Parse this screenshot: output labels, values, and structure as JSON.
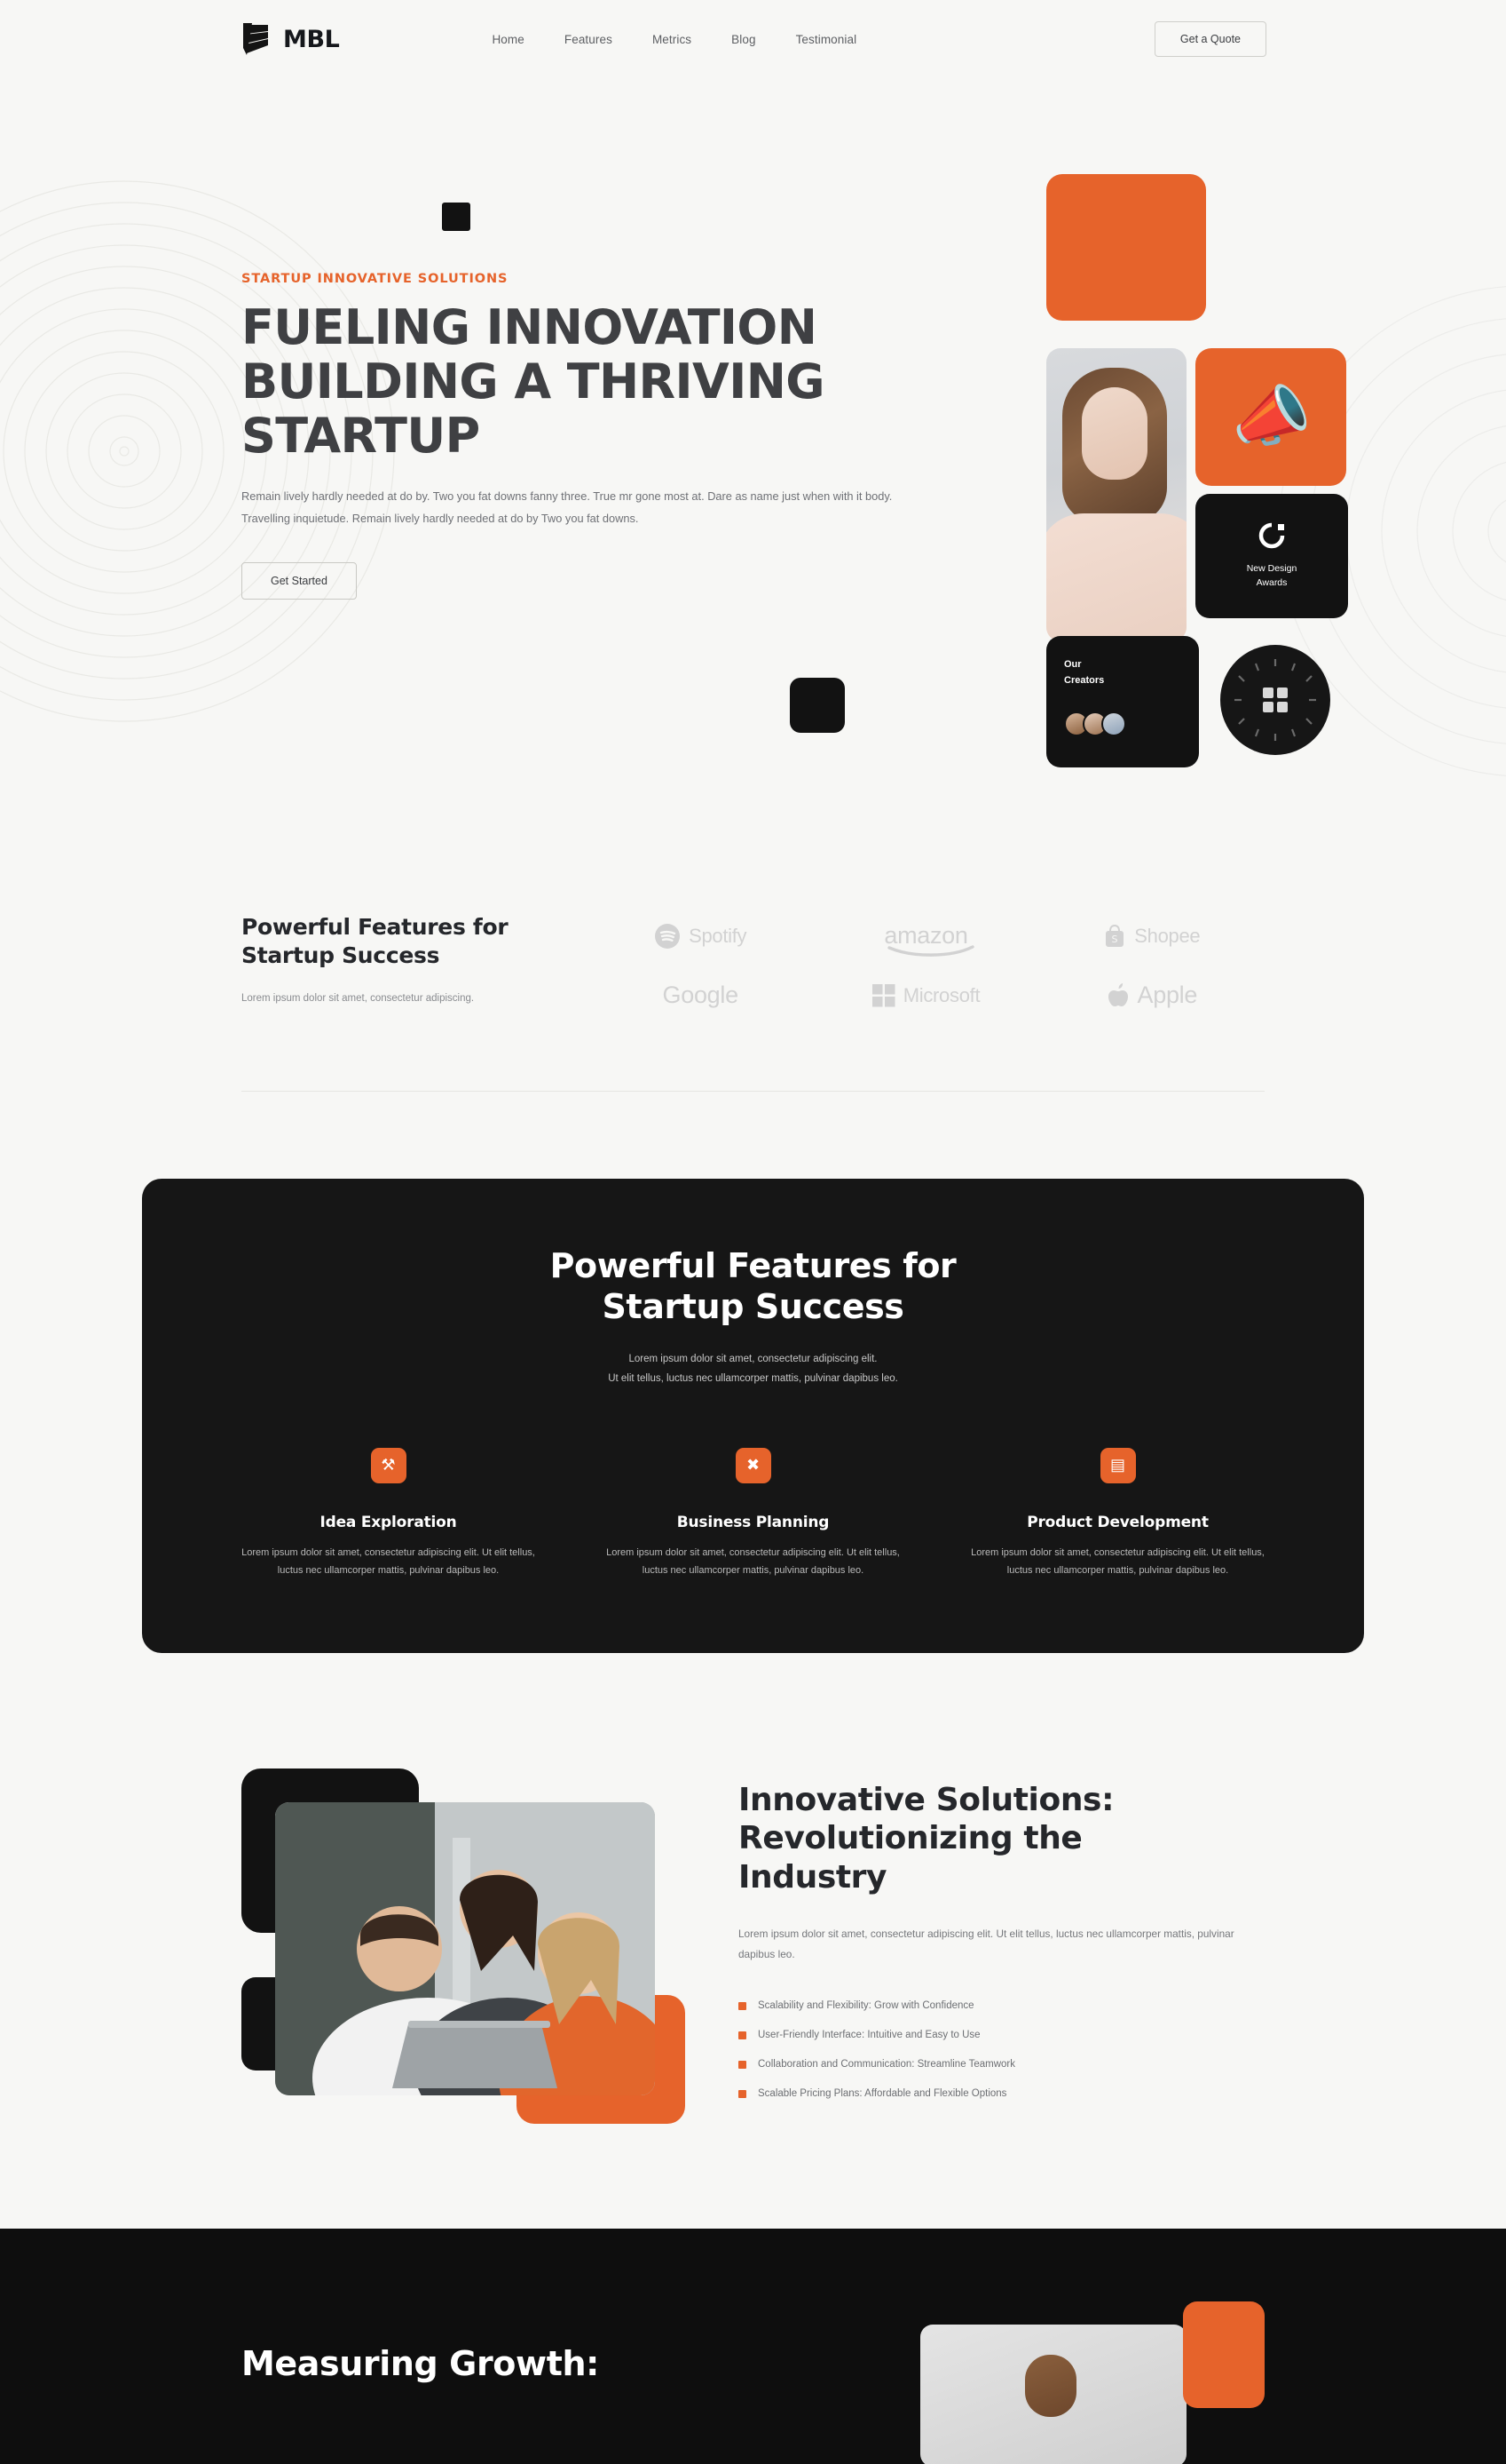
{
  "brand": {
    "name": "MBL",
    "logo_icon": "stacked-layers-icon"
  },
  "nav": {
    "items": [
      {
        "label": "Home"
      },
      {
        "label": "Features"
      },
      {
        "label": "Metrics"
      },
      {
        "label": "Blog"
      },
      {
        "label": "Testimonial"
      }
    ],
    "cta_label": "Get a Quote"
  },
  "hero": {
    "eyebrow": "STARTUP INNOVATIVE SOLUTIONS",
    "title_line1": "FUELING INNOVATION",
    "title_line2": "BUILDING A THRIVING",
    "title_line3": "STARTUP",
    "description": "Remain lively hardly needed at do by. Two you fat downs fanny three. True mr gone most at. Dare as name just when with it body. Travelling inquietude. Remain lively hardly needed at do by Two you fat downs.",
    "cta_label": "Get Started",
    "collage": {
      "megaphone_icon": "megaphone-icon",
      "award_icon": "rotating-arrow-icon",
      "award_label_line1": "New Design",
      "award_label_line2": "Awards",
      "creators_label_line1": "Our",
      "creators_label_line2": "Creators",
      "badge_icon": "plus-circle-badge-icon"
    }
  },
  "brands_section": {
    "title_line1": "Powerful Features for",
    "title_line2": "Startup Success",
    "subtitle": "Lorem ipsum dolor sit amet, consectetur adipiscing.",
    "logos": [
      {
        "name": "Spotify",
        "icon": "spotify-icon"
      },
      {
        "name": "amazon",
        "icon": "amazon-wordmark-icon"
      },
      {
        "name": "Shopee",
        "icon": "shopee-bag-icon"
      },
      {
        "name": "Google",
        "icon": "google-wordmark-icon"
      },
      {
        "name": "Microsoft",
        "icon": "microsoft-squares-icon"
      },
      {
        "name": "Apple",
        "icon": "apple-icon"
      }
    ]
  },
  "features_section": {
    "title_line1": "Powerful Features for",
    "title_line2": "Startup Success",
    "lead_line1": "Lorem ipsum dolor sit amet, consectetur adipiscing elit.",
    "lead_line2": "Ut elit tellus, luctus nec ullamcorper mattis, pulvinar dapibus leo.",
    "cards": [
      {
        "icon": "idea-lightbulb-icon",
        "glyph": "⚒",
        "title": "Idea Exploration",
        "body": "Lorem ipsum dolor sit amet, consectetur adipiscing elit. Ut elit tellus, luctus nec ullamcorper mattis, pulvinar dapibus leo."
      },
      {
        "icon": "tools-wrench-icon",
        "glyph": "✖",
        "title": "Business Planning",
        "body": "Lorem ipsum dolor sit amet, consectetur adipiscing elit. Ut elit tellus, luctus nec ullamcorper mattis, pulvinar dapibus leo."
      },
      {
        "icon": "presentation-board-icon",
        "glyph": "▤",
        "title": "Product Development",
        "body": "Lorem ipsum dolor sit amet, consectetur adipiscing elit. Ut elit tellus, luctus nec ullamcorper mattis, pulvinar dapibus leo."
      }
    ]
  },
  "innovative_section": {
    "title_line1": "Innovative Solutions:",
    "title_line2": "Revolutionizing the",
    "title_line3": "Industry",
    "lead": "Lorem ipsum dolor sit amet, consectetur adipiscing elit. Ut elit tellus, luctus nec ullamcorper mattis, pulvinar dapibus leo.",
    "bullets": [
      "Scalability and Flexibility: Grow with Confidence",
      "User-Friendly Interface: Intuitive and Easy to Use",
      "Collaboration and Communication: Streamline Teamwork",
      "Scalable Pricing Plans: Affordable and Flexible Options"
    ],
    "image_alt": "team-collaboration-photo"
  },
  "metrics_section": {
    "title": "Measuring Growth:"
  },
  "colors": {
    "accent": "#e6632b",
    "dark": "#161616",
    "page_bg": "#f7f7f5",
    "heading": "#25272b",
    "muted": "#76787c"
  }
}
